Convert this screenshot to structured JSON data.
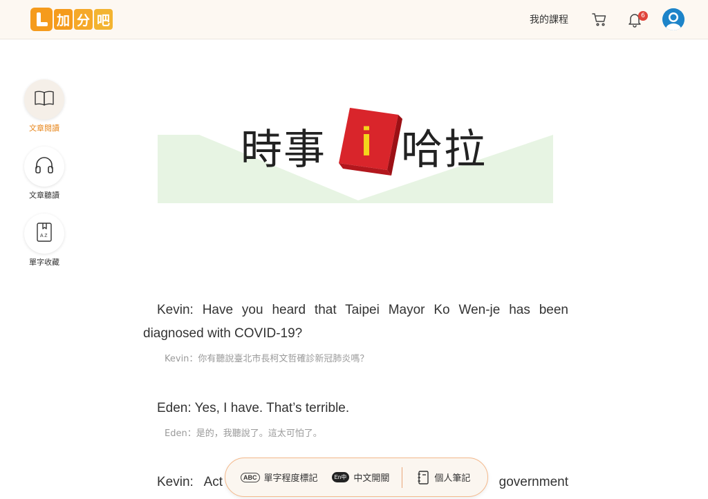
{
  "header": {
    "logo_chars": [
      "加",
      "分",
      "吧"
    ],
    "my_courses": "我的課程",
    "notification_count": "6"
  },
  "sidebar": {
    "items": [
      {
        "label": "文章閱讀",
        "icon": "book-icon",
        "active": true
      },
      {
        "label": "文章聽讀",
        "icon": "headphones-icon",
        "active": false
      },
      {
        "label": "單字收藏",
        "icon": "bookmark-az-icon",
        "active": false
      }
    ]
  },
  "banner": {
    "left_text": "時事",
    "center_letter": "i",
    "right_text": "哈拉"
  },
  "article": {
    "paragraphs": [
      {
        "en": "Kevin: Have you heard that Taipei Mayor Ko Wen-je has been diagnosed with COVID-19?",
        "zh": "Kevin：你有聽說臺北市長柯文哲確診新冠肺炎嗎？"
      },
      {
        "en": "Eden: Yes, I have. That’s terrible.",
        "zh": "Eden：是的，我聽說了。這太可怕了。"
      },
      {
        "en": "Kevin: Actually, ... government",
        "zh": ""
      }
    ],
    "partial_line_left": "Kevin:   Act",
    "partial_line_right": "government"
  },
  "toolbar": {
    "vocab_level_icon_text": "ABC",
    "vocab_level_label": "單字程度標記",
    "chinese_toggle_icon_text": "En中",
    "chinese_toggle_label": "中文開關",
    "notes_label": "個人筆記"
  },
  "colors": {
    "accent": "#e7861b",
    "header_bg": "#fdf8f2",
    "banner_red": "#d9252b",
    "banner_green": "#e7f4e3"
  }
}
